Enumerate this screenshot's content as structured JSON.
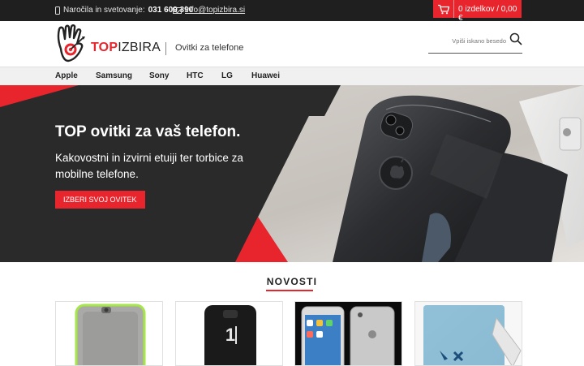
{
  "topbar": {
    "contact_label": "Naročila in svetovanje:",
    "phone": "031 609 390",
    "email": "info@topizbira.si",
    "icons": [
      "phone-icon",
      "mail-icon",
      "cart-icon"
    ]
  },
  "cart": {
    "summary": "0 izdelkov / 0,00 €"
  },
  "header": {
    "logo_top": "TOP",
    "logo_rest": "IZBIRA",
    "tagline": "Ovitki za telefone",
    "search_placeholder": "Vpiši iskano besedo"
  },
  "nav": {
    "items": [
      {
        "label": "Apple"
      },
      {
        "label": "Samsung"
      },
      {
        "label": "Sony"
      },
      {
        "label": "HTC"
      },
      {
        "label": "LG"
      },
      {
        "label": "Huawei"
      }
    ]
  },
  "hero": {
    "title": "TOP ovitki za vaš telefon.",
    "subtitle": "Kakovostni in izvirni etuiji ter torbice za mobilne telefone.",
    "button": "IZBERI SVOJ OVITEK"
  },
  "section": {
    "title": "NOVOSTI"
  },
  "colors": {
    "accent": "#e8242c",
    "dark": "#1f1f1f",
    "nav_bg": "#f0f0f0"
  }
}
